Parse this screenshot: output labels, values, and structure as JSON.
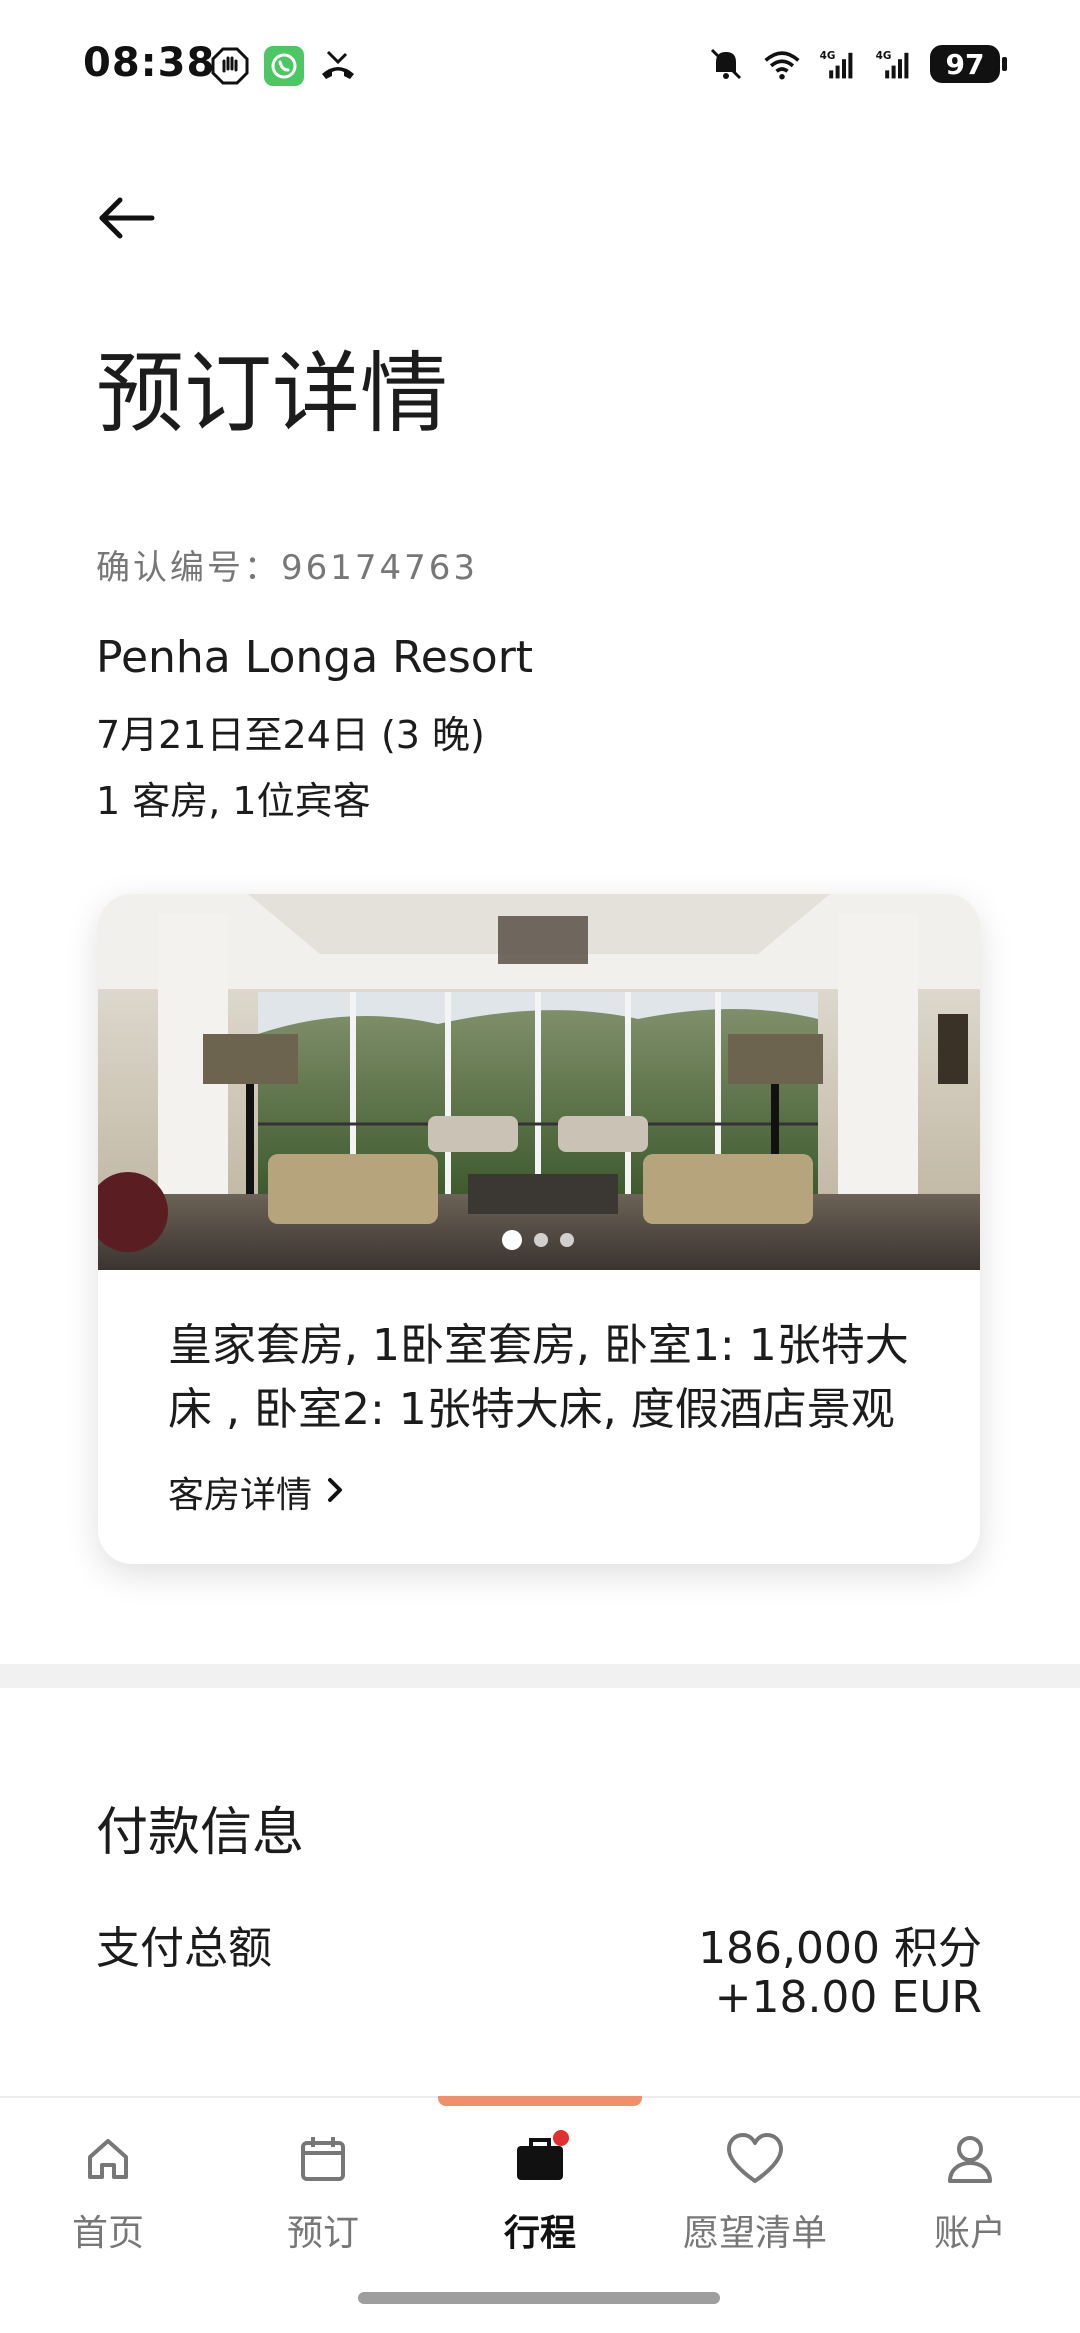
{
  "status_bar": {
    "time": "08:38",
    "battery": "97",
    "left_icons": [
      "stop-hand-icon",
      "whatsapp-icon",
      "missed-call-icon"
    ],
    "right_icons": [
      "mute-icon",
      "wifi-icon",
      "signal-4g-icon",
      "signal-4g-icon",
      "battery-icon"
    ]
  },
  "header": {
    "back_icon": "back-arrow-icon",
    "title": "预订详情"
  },
  "booking": {
    "confirmation_label": "确认编号：",
    "confirmation_number": "96174763",
    "hotel_name": "Penha Longa Resort",
    "dates": "7月21日至24日 (3 晚)",
    "guests": "1 客房, 1位宾客"
  },
  "room_card": {
    "photo_dots": 3,
    "active_dot": 0,
    "description": "皇家套房, 1卧室套房, 卧室1: 1张特大床 , 卧室2: 1张特大床, 度假酒店景观",
    "details_link": "客房详情"
  },
  "payment": {
    "title": "付款信息",
    "total_label": "支付总额",
    "total_points": "186,000 积分",
    "total_cash": "+18.00 EUR"
  },
  "bottom_nav": {
    "items": [
      {
        "label": "首页",
        "icon": "home-icon"
      },
      {
        "label": "预订",
        "icon": "calendar-icon"
      },
      {
        "label": "行程",
        "icon": "suitcase-icon",
        "active": true,
        "badge": true
      },
      {
        "label": "愿望清单",
        "icon": "heart-icon"
      },
      {
        "label": "账户",
        "icon": "person-icon"
      }
    ]
  },
  "colors": {
    "accent": "#f0906a",
    "badge": "#e03030",
    "text": "#1c1c1c",
    "muted": "#777777"
  }
}
